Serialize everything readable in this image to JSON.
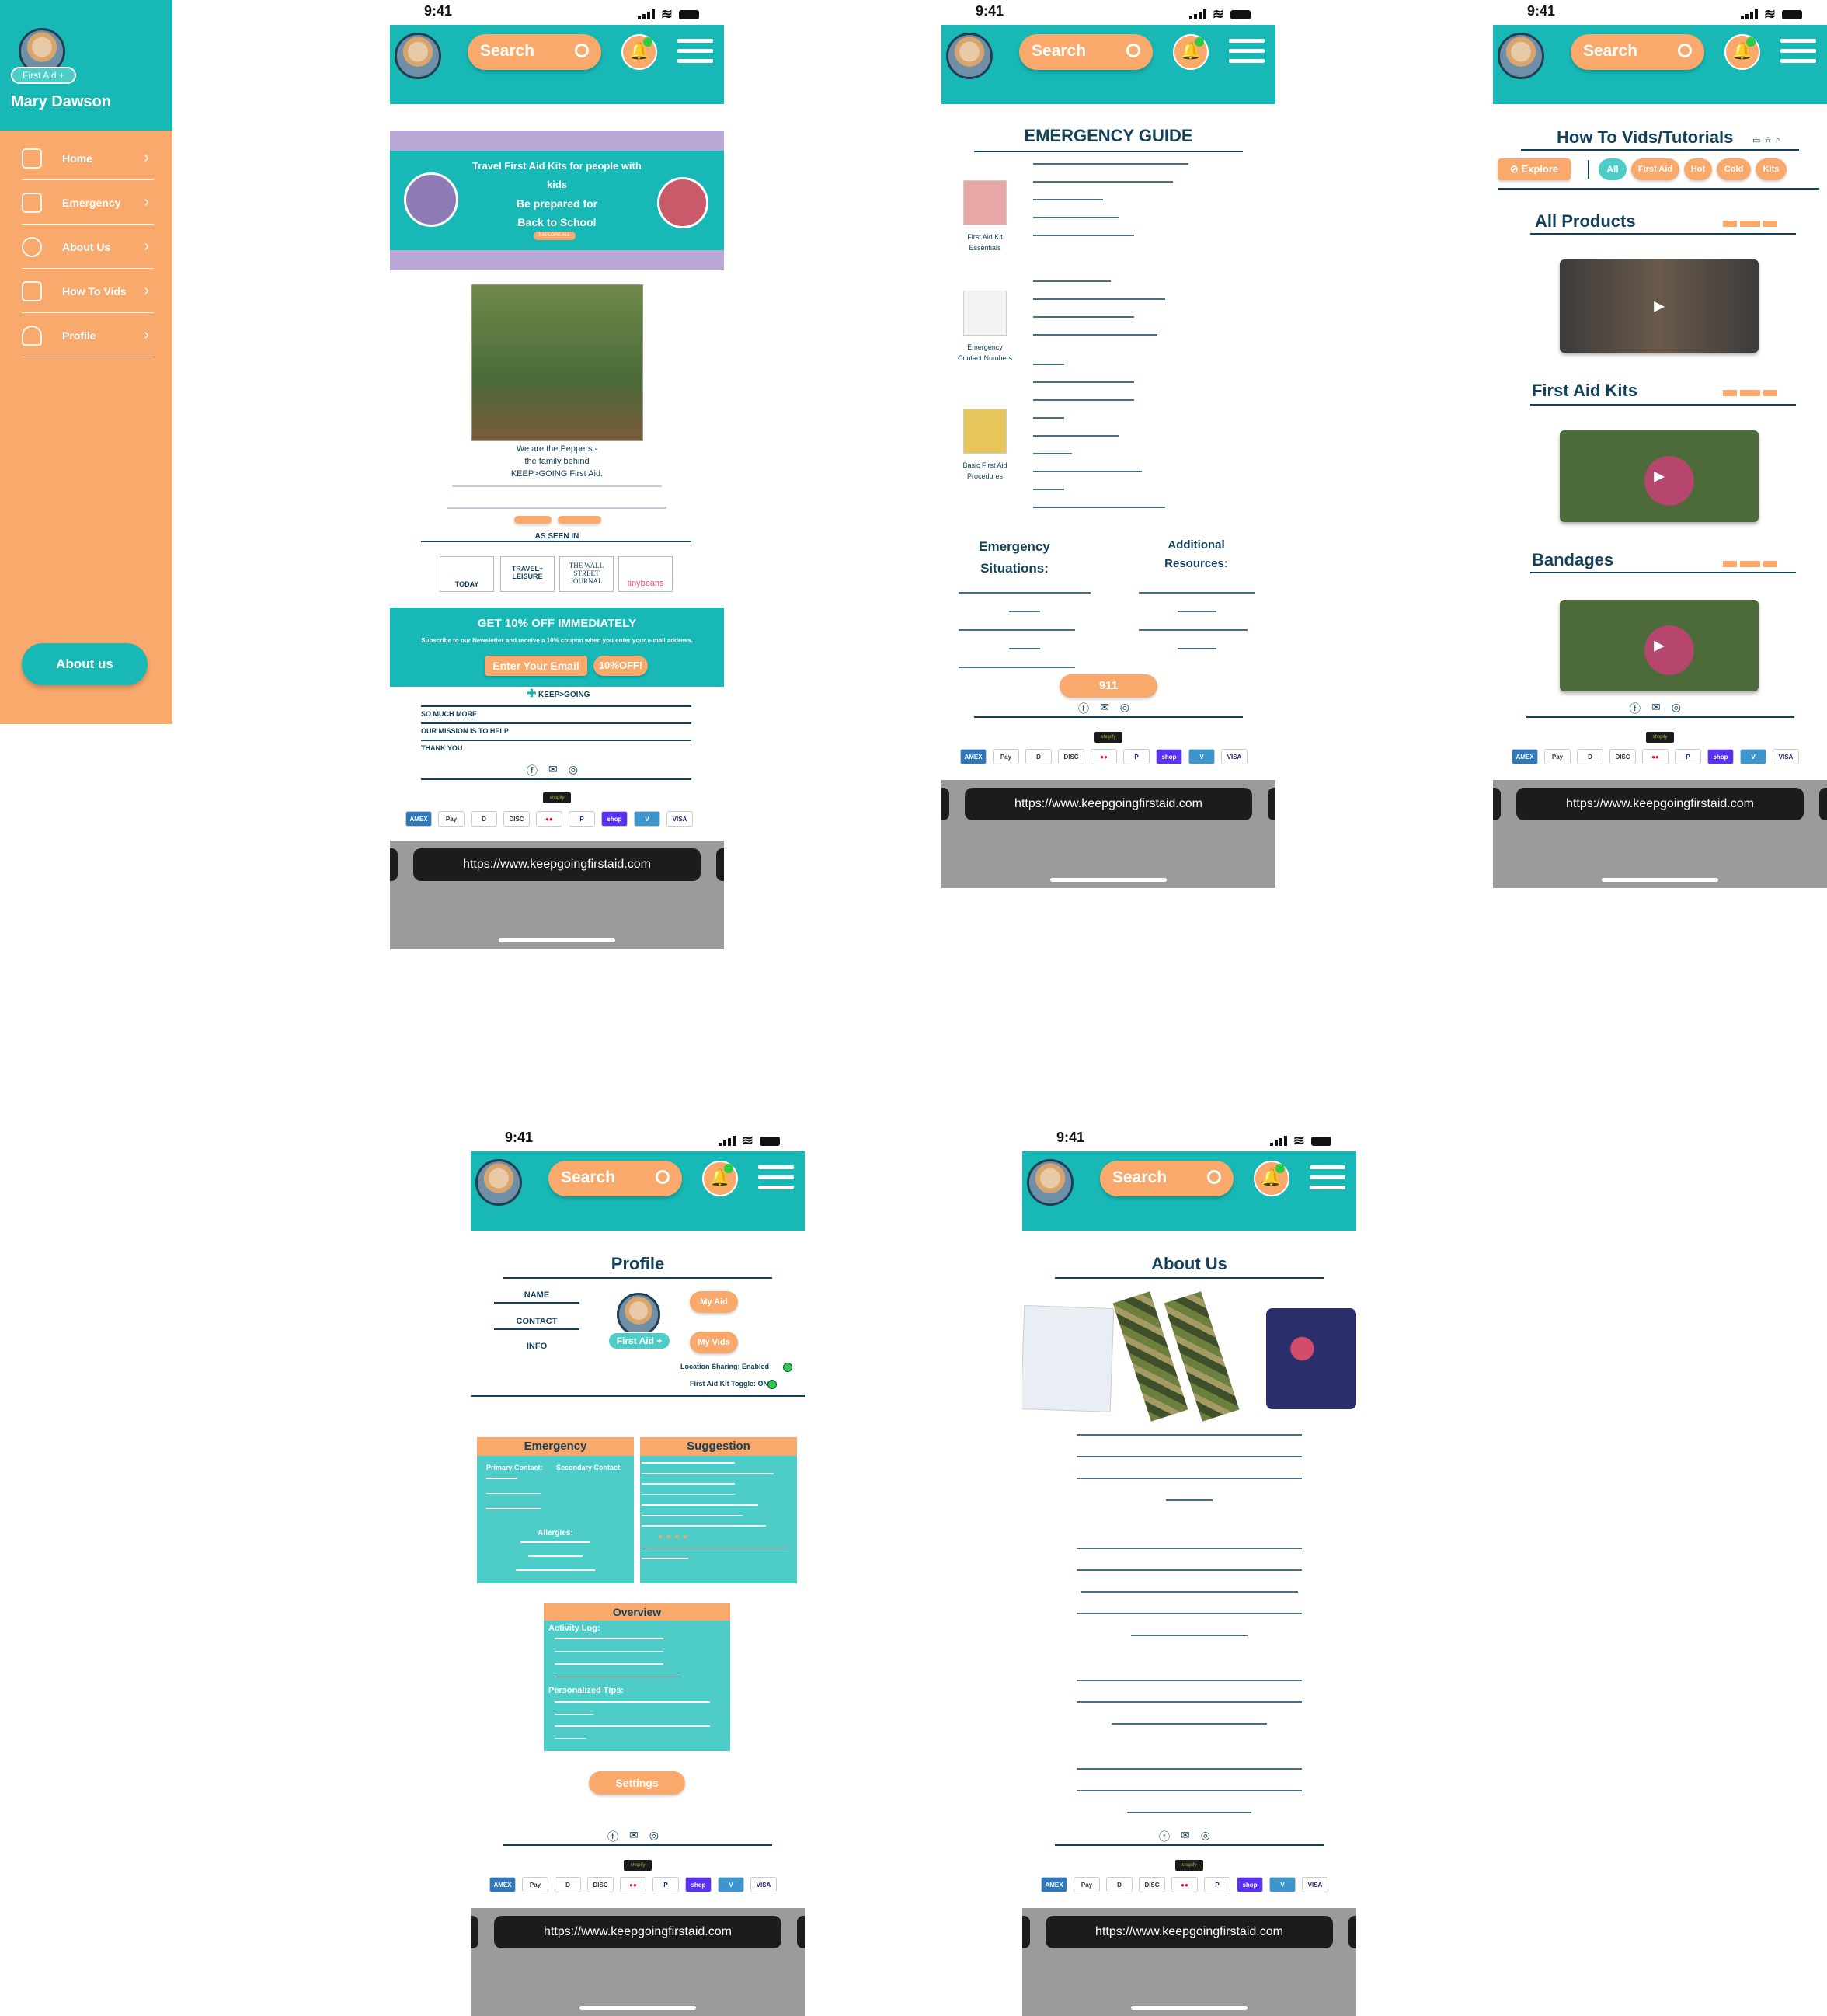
{
  "status": {
    "time": "9:41"
  },
  "url": "https://www.keepgoingfirstaid.com",
  "header": {
    "search_label": "Search"
  },
  "sidebar": {
    "badge": "First Aid +",
    "user_name": "Mary Dawson",
    "items": [
      {
        "label": "Home"
      },
      {
        "label": "Emergency"
      },
      {
        "label": "About Us"
      },
      {
        "label": "How To Vids"
      },
      {
        "label": "Profile"
      }
    ],
    "about_button": "About us"
  },
  "home": {
    "banner_line1": "Travel First Aid Kits for people with",
    "banner_line2": "kids",
    "banner_line3": "Be prepared for",
    "banner_line4": "Back to School",
    "banner_cta": "EXPLORE ALL",
    "intro_line1": "We are the Peppers -",
    "intro_line2": "the family behind",
    "intro_line3": "KEEP>GOING First Aid.",
    "as_seen_in": "AS SEEN IN",
    "press": [
      "TODAY",
      "TRAVEL+ LEISURE",
      "THE WALL STREET JOURNAL",
      "tinybeans"
    ],
    "offer_title": "GET 10% OFF IMMEDIATELY",
    "offer_sub": "Subscribe to our Newsletter and receive a 10% coupon when you enter your e-mail address.",
    "email_placeholder": "Enter Your Email",
    "offer_button": "10%OFF!",
    "brand": "KEEP>GOING",
    "links": [
      "SO MUCH MORE",
      "OUR MISSION IS TO HELP",
      "THANK YOU"
    ]
  },
  "emergency": {
    "title": "EMERGENCY GUIDE",
    "cards": [
      {
        "label": "First Aid Kit Essentials"
      },
      {
        "label": "Emergency Contact Numbers"
      },
      {
        "label": "Basic First Aid Procedures"
      }
    ],
    "situations_title": "Emergency Situations:",
    "resources_title": "Additional Resources:",
    "call_button": "911"
  },
  "vids": {
    "title": "How To Vids/Tutorials",
    "explore": "Explore",
    "filters": [
      "All",
      "First Aid",
      "Hot",
      "Cold",
      "Kits"
    ],
    "sections": [
      "All Products",
      "First Aid Kits",
      "Bandages"
    ]
  },
  "profile": {
    "title": "Profile",
    "fields": [
      "NAME",
      "CONTACT",
      "INFO"
    ],
    "my_aid": "My Aid",
    "my_vids": "My Vids",
    "badge": "First Aid +",
    "location_sharing": "Location Sharing: Enabled",
    "kit_toggle": "First Aid Kit Toggle: ON",
    "emergency_title": "Emergency",
    "primary_contact": "Primary Contact:",
    "secondary_contact": "Secondary Contact:",
    "allergies": "Allergies:",
    "suggestion_title": "Suggestion",
    "overview_title": "Overview",
    "activity_log": "Activity Log:",
    "personalized_tips": "Personalized Tips:",
    "settings": "Settings"
  },
  "about": {
    "title": "About Us"
  },
  "colors": {
    "teal": "#17b8b6",
    "orange": "#f9a96b",
    "navy": "#13405a"
  }
}
